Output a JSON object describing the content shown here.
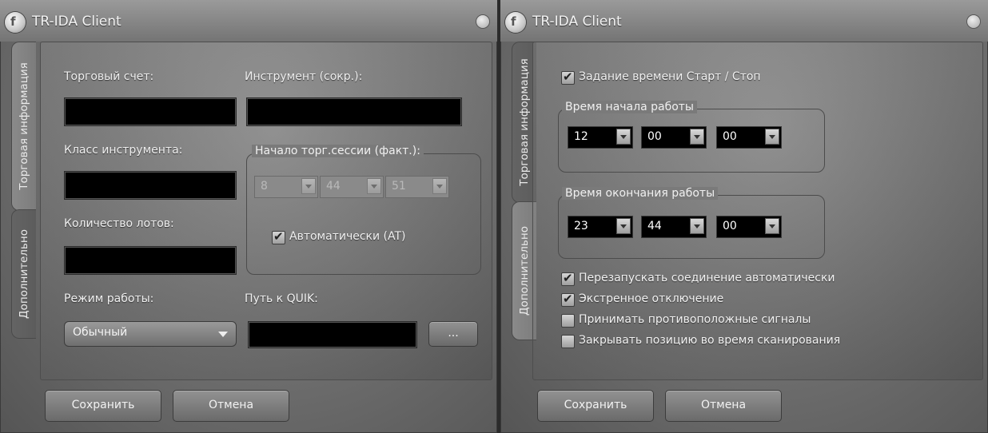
{
  "window1": {
    "title": "TR-IDA Client",
    "tabs": {
      "active": "Торговая информация",
      "inactive": "Дополнительно"
    },
    "labels": {
      "account": "Торговый счет:",
      "instrument": "Инструмент (сокр.):",
      "class": "Класс инструмента:",
      "session_start": "Начало торг.сессии (факт.):",
      "lots": "Количество лотов:",
      "mode": "Режим работы:",
      "quik_path": "Путь к QUIK:"
    },
    "session_start": {
      "hour": "8",
      "minute": "44",
      "second": "51"
    },
    "auto_checkbox": {
      "label": "Автоматически (AT)",
      "checked": true
    },
    "mode_value": "Обычный",
    "browse_label": "...",
    "save_label": "Сохранить",
    "cancel_label": "Отмена"
  },
  "window2": {
    "title": "TR-IDA Client",
    "tabs": {
      "active": "Торговая информация",
      "inactive": "Дополнительно"
    },
    "start_stop": {
      "label": "Задание времени Старт / Стоп",
      "checked": true
    },
    "start_group": {
      "title": "Время начала работы",
      "hour": "12",
      "minute": "00",
      "second": "00"
    },
    "end_group": {
      "title": "Время окончания работы",
      "hour": "23",
      "minute": "44",
      "second": "00"
    },
    "options": [
      {
        "label": "Перезапускать соединение автоматически",
        "checked": true
      },
      {
        "label": "Экстренное отключение",
        "checked": true
      },
      {
        "label": "Принимать противоположные сигналы",
        "checked": false
      },
      {
        "label": "Закрывать позицию во время сканирования",
        "checked": false
      }
    ],
    "save_label": "Сохранить",
    "cancel_label": "Отмена"
  }
}
